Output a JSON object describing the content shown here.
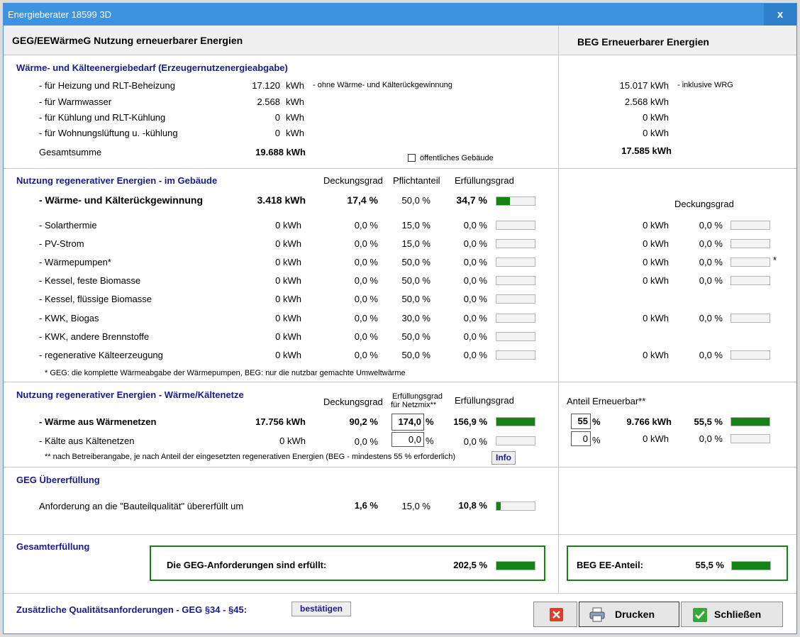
{
  "window": {
    "title": "Energieberater 18599 3D",
    "close_label": "x"
  },
  "header": {
    "left": "GEG/EEWärmeG  Nutzung erneuerbarer Energien",
    "right": "BEG  Erneuerbarer Energien"
  },
  "bedarf": {
    "title": "Wärme- und Kälteenergiebedarf (Erzeugernutzenergieabgabe)",
    "rows": [
      {
        "label": "- für Heizung und RLT-Beheizung",
        "value": "17.120",
        "unit": "kWh",
        "note": "-  ohne Wärme- und Kälterückgewinnung",
        "beg_value": "15.017 kWh",
        "beg_note": "-  inklusive WRG"
      },
      {
        "label": "- für Warmwasser",
        "value": "2.568",
        "unit": "kWh",
        "beg_value": "2.568 kWh"
      },
      {
        "label": "- für Kühlung und RLT-Kühlung",
        "value": "0",
        "unit": "kWh",
        "beg_value": "0 kWh"
      },
      {
        "label": "- für Wohnungslüftung u. -kühlung",
        "value": "0",
        "unit": "kWh",
        "beg_value": "0 kWh"
      }
    ],
    "total_label": "Gesamtsumme",
    "total_value": "19.688 kWh",
    "beg_total": "17.585 kWh",
    "public_building_label": "öffentliches Gebäude"
  },
  "gebaeude": {
    "title": "Nutzung regenerativer Energien - im Gebäude",
    "col_deckung": "Deckungsgrad",
    "col_pflicht": "Pflichtanteil",
    "col_erfuellung": "Erfüllungsgrad",
    "beg_col_deckung": "Deckungsgrad",
    "wrg": {
      "label": "- Wärme- und Kälterückgewinnung",
      "value": "3.418 kWh",
      "deckung": "17,4 %",
      "pflicht": "50,0 %",
      "erfuellung": "34,7 %",
      "fill": 0.347
    },
    "rows": [
      {
        "label": "- Solarthermie",
        "value": "0 kWh",
        "deckung": "0,0 %",
        "pflicht": "15,0 %",
        "erfuellung": "0,0 %",
        "beg_value": "0 kWh",
        "beg_deckung": "0,0 %"
      },
      {
        "label": "- PV-Strom",
        "value": "0 kWh",
        "deckung": "0,0 %",
        "pflicht": "15,0 %",
        "erfuellung": "0,0 %",
        "beg_value": "0 kWh",
        "beg_deckung": "0,0 %"
      },
      {
        "label": "- Wärmepumpen*",
        "value": "0 kWh",
        "deckung": "0,0 %",
        "pflicht": "50,0 %",
        "erfuellung": "0,0 %",
        "beg_value": "0 kWh",
        "beg_deckung": "0,0 %",
        "beg_star": "*"
      },
      {
        "label": "- Kessel, feste Biomasse",
        "value": "0 kWh",
        "deckung": "0,0 %",
        "pflicht": "50,0 %",
        "erfuellung": "0,0 %",
        "beg_value": "0 kWh",
        "beg_deckung": "0,0 %"
      },
      {
        "label": "- Kessel, flüssige Biomasse",
        "value": "0 kWh",
        "deckung": "0,0 %",
        "pflicht": "50,0 %",
        "erfuellung": "0,0 %"
      },
      {
        "label": "- KWK, Biogas",
        "value": "0 kWh",
        "deckung": "0,0 %",
        "pflicht": "30,0 %",
        "erfuellung": "0,0 %",
        "beg_value": "0 kWh",
        "beg_deckung": "0,0 %"
      },
      {
        "label": "- KWK, andere Brennstoffe",
        "value": "0 kWh",
        "deckung": "0,0 %",
        "pflicht": "50,0 %",
        "erfuellung": "0,0 %"
      },
      {
        "label": "- regenerative Kälteerzeugung",
        "value": "0 kWh",
        "deckung": "0,0 %",
        "pflicht": "50,0 %",
        "erfuellung": "0,0 %",
        "beg_value": "0 kWh",
        "beg_deckung": "0,0 %"
      }
    ],
    "footnote": "* GEG: die komplette Wärmeabgabe der Wärmepumpen, BEG: nur die nutzbar gemachte Umweltwärme"
  },
  "netze": {
    "title": "Nutzung regenerativer Energien - Wärme/Kältenetze",
    "col_deckung": "Deckungsgrad",
    "col_erf_netz_1": "Erfüllungsgrad",
    "col_erf_netz_2": "für Netzmix**",
    "col_erfuellung": "Erfüllungsgrad",
    "beg_col": "Anteil Erneuerbar**",
    "waerme": {
      "label": "- Wärme aus Wärmenetzen",
      "value": "17.756 kWh",
      "deckung": "90,2 %",
      "netzmix": "174,0",
      "erfuellung": "156,9 %",
      "fill": 1.0,
      "beg_anteil": "55",
      "beg_value": "9.766 kWh",
      "beg_percent": "55,5 %",
      "beg_fill": 1.0
    },
    "kaelte": {
      "label": "- Kälte aus Kältenetzen",
      "value": "0 kWh",
      "deckung": "0,0 %",
      "netzmix": "0,0",
      "erfuellung": "0,0 %",
      "beg_anteil": "0",
      "beg_value": "0 kWh",
      "beg_percent": "0,0 %"
    },
    "pct": "%",
    "footnote": "** nach Betreiberangabe, je nach Anteil der eingesetzten regenerativen Energien (BEG - mindestens 55 % erforderlich)",
    "info_label": "Info"
  },
  "ueber": {
    "title": "GEG Übererfüllung",
    "label": "Anforderung an die \"Bauteilqualität\" übererfüllt um",
    "value": "1,6 %",
    "pflicht": "15,0 %",
    "erfuellung": "10,8 %",
    "fill": 0.108
  },
  "gesamt": {
    "title": "Gesamterfüllung",
    "geg_label": "Die GEG-Anforderungen sind erfüllt:",
    "geg_value": "202,5 %",
    "geg_fill": 1.0,
    "beg_label": "BEG  EE-Anteil:",
    "beg_value": "55,5 %",
    "beg_fill": 1.0
  },
  "footer": {
    "zusatz_label": "Zusätzliche Qualitätsanforderungen - GEG §34 - §45:",
    "confirm_label": "bestätigen",
    "print_label": "Drucken",
    "close_label": "Schließen"
  },
  "colors": {
    "accent": "#3d93e0",
    "bar_fill": "#148214",
    "section_title": "#1a1a8c"
  }
}
